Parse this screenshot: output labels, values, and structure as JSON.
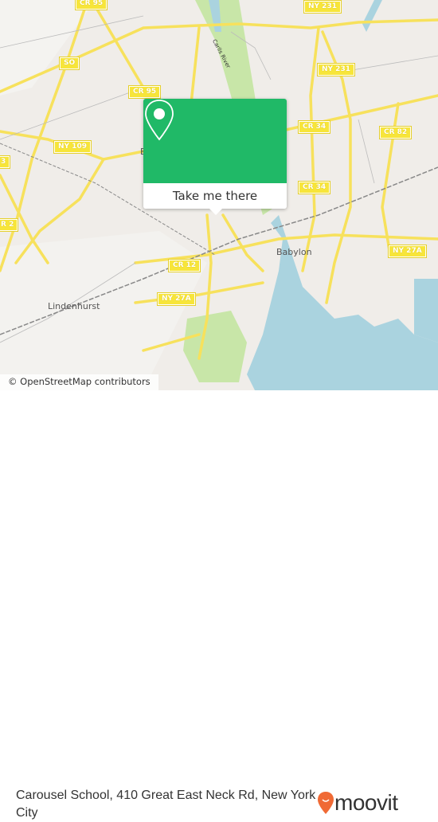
{
  "map": {
    "shields": [
      "CR 95",
      "NY 231",
      "SO",
      "NY 231",
      "CR 95",
      "CR 34",
      "CR 82",
      "NY 109",
      "3",
      "CR 34",
      "R 2",
      "CR 12",
      "NY 27A",
      "NY 27A"
    ],
    "places": [
      "Babylon",
      "Lindenhurst",
      "B"
    ],
    "river": "Carlls River",
    "colors": {
      "land": "#f0ede9",
      "water": "#aad3df",
      "park": "#c8e6a8",
      "road": "#f7e15c",
      "accent": "#20b967"
    }
  },
  "popup": {
    "icon": "map-pin-icon",
    "button_label": "Take me there"
  },
  "attribution": "© OpenStreetMap contributors",
  "footer": {
    "title": "Carousel School, 410 Great East Neck Rd, New York City",
    "logo_text": "moovit",
    "logo_color": "#f06a35"
  }
}
